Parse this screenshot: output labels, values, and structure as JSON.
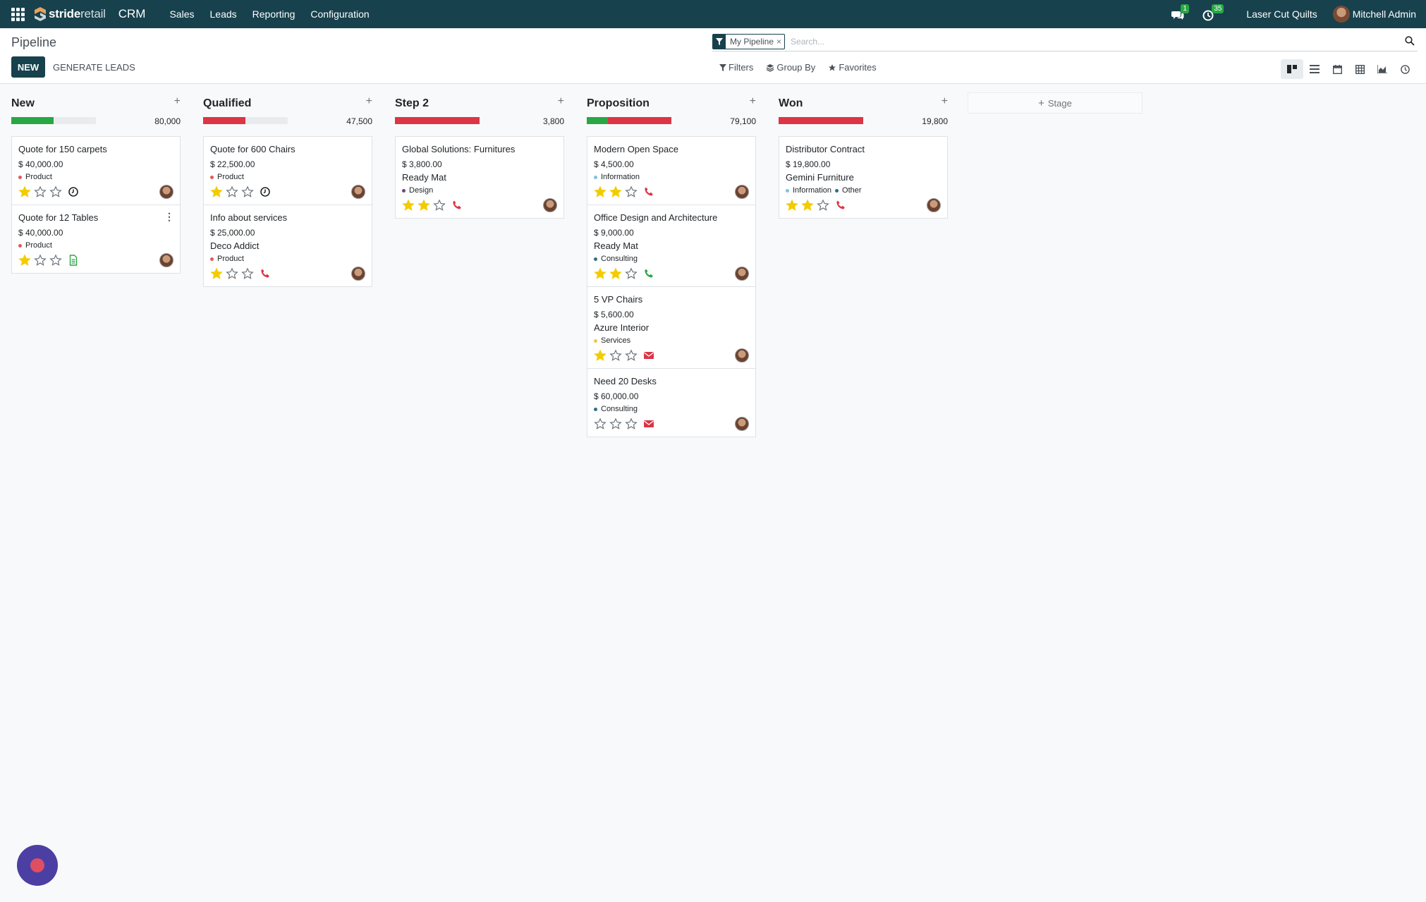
{
  "navbar": {
    "brand": {
      "strong": "stride",
      "light": "retail"
    },
    "app_name": "CRM",
    "menu": [
      "Sales",
      "Leads",
      "Reporting",
      "Configuration"
    ],
    "messages_count": "1",
    "activities_count": "35",
    "company": "Laser Cut Quilts",
    "user": "Mitchell Admin"
  },
  "control": {
    "title": "Pipeline",
    "new_label": "NEW",
    "generate_label": "GENERATE LEADS",
    "facet_label": "My Pipeline",
    "facet_close": "×",
    "search_placeholder": "Search...",
    "filters_label": "Filters",
    "groupby_label": "Group By",
    "favorites_label": "Favorites"
  },
  "colors": {
    "navbar": "#17414d",
    "progress_green": "#28a745",
    "progress_red": "#dc3545",
    "star": "#f3cc00"
  },
  "add_stage_label": "Stage",
  "columns": [
    {
      "title": "New",
      "total": "80,000",
      "progress": {
        "green": 0.5,
        "red": 0
      },
      "cards": [
        {
          "title": "Quote for 150 carpets",
          "amount": "$ 40,000.00",
          "company": "",
          "tags": [
            {
              "label": "Product",
              "color": "#e05a5a"
            }
          ],
          "stars": 1,
          "activity": "clock",
          "menu": false
        },
        {
          "title": "Quote for 12 Tables",
          "amount": "$ 40,000.00",
          "company": "",
          "tags": [
            {
              "label": "Product",
              "color": "#e05a5a"
            }
          ],
          "stars": 1,
          "activity": "document",
          "menu": true
        }
      ]
    },
    {
      "title": "Qualified",
      "total": "47,500",
      "progress": {
        "green": 0,
        "red": 0.5
      },
      "cards": [
        {
          "title": "Quote for 600 Chairs",
          "amount": "$ 22,500.00",
          "company": "",
          "tags": [
            {
              "label": "Product",
              "color": "#e05a5a"
            }
          ],
          "stars": 1,
          "activity": "clock",
          "menu": false
        },
        {
          "title": "Info about services",
          "amount": "$ 25,000.00",
          "company": "Deco Addict",
          "tags": [
            {
              "label": "Product",
              "color": "#e05a5a"
            }
          ],
          "stars": 1,
          "activity": "phone-red",
          "menu": false
        }
      ]
    },
    {
      "title": "Step 2",
      "total": "3,800",
      "progress": {
        "green": 0,
        "red": 1
      },
      "cards": [
        {
          "title": "Global Solutions: Furnitures",
          "amount": "$ 3,800.00",
          "company": "Ready Mat",
          "tags": [
            {
              "label": "Design",
              "color": "#6b4a7a"
            }
          ],
          "stars": 2,
          "activity": "phone-red",
          "menu": false
        }
      ]
    },
    {
      "title": "Proposition",
      "total": "79,100",
      "progress": {
        "green": 0.25,
        "red": 0.75
      },
      "cards": [
        {
          "title": "Modern Open Space",
          "amount": "$ 4,500.00",
          "company": "",
          "tags": [
            {
              "label": "Information",
              "color": "#7ec3e0"
            }
          ],
          "stars": 2,
          "activity": "phone-red",
          "menu": false
        },
        {
          "title": "Office Design and Architecture",
          "amount": "$ 9,000.00",
          "company": "Ready Mat",
          "tags": [
            {
              "label": "Consulting",
              "color": "#2d6f8a"
            }
          ],
          "stars": 2,
          "activity": "phone-green",
          "menu": false
        },
        {
          "title": "5 VP Chairs",
          "amount": "$ 5,600.00",
          "company": "Azure Interior",
          "tags": [
            {
              "label": "Services",
              "color": "#f0c34a"
            }
          ],
          "stars": 1,
          "activity": "email-red",
          "menu": false
        },
        {
          "title": "Need 20 Desks",
          "amount": "$ 60,000.00",
          "company": "",
          "tags": [
            {
              "label": "Consulting",
              "color": "#2d6f8a"
            }
          ],
          "stars": 0,
          "activity": "email-red",
          "menu": false
        }
      ]
    },
    {
      "title": "Won",
      "total": "19,800",
      "progress": {
        "green": 0,
        "red": 1
      },
      "cards": [
        {
          "title": "Distributor Contract",
          "amount": "$ 19,800.00",
          "company": "Gemini Furniture",
          "tags": [
            {
              "label": "Information",
              "color": "#7ec3e0"
            },
            {
              "label": "Other",
              "color": "#2d6f8a"
            }
          ],
          "stars": 2,
          "activity": "phone-red",
          "menu": false
        }
      ]
    }
  ]
}
